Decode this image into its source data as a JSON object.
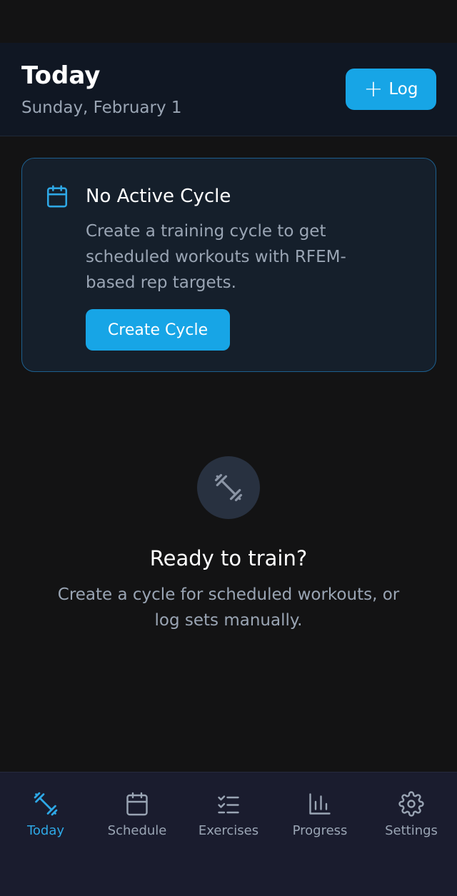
{
  "header": {
    "title": "Today",
    "date": "Sunday, February 1",
    "log_button_label": "Log"
  },
  "cycle_card": {
    "title": "No Active Cycle",
    "description": "Create a training cycle to get scheduled workouts with RFEM-based rep targets.",
    "button_label": "Create Cycle",
    "icon": "calendar-icon"
  },
  "empty_state": {
    "icon": "dumbbell-icon",
    "title": "Ready to train?",
    "description": "Create a cycle for scheduled workouts, or log sets manually."
  },
  "bottom_nav": {
    "items": [
      {
        "label": "Today",
        "icon": "dumbbell-icon",
        "active": true
      },
      {
        "label": "Schedule",
        "icon": "calendar-icon",
        "active": false
      },
      {
        "label": "Exercises",
        "icon": "checklist-icon",
        "active": false
      },
      {
        "label": "Progress",
        "icon": "bar-chart-icon",
        "active": false
      },
      {
        "label": "Settings",
        "icon": "gear-icon",
        "active": false
      }
    ]
  },
  "colors": {
    "accent": "#17a5e6",
    "background": "#131314",
    "card": "#151f2b",
    "nav": "#1a1c2e",
    "muted_text": "#9aa5b4"
  }
}
